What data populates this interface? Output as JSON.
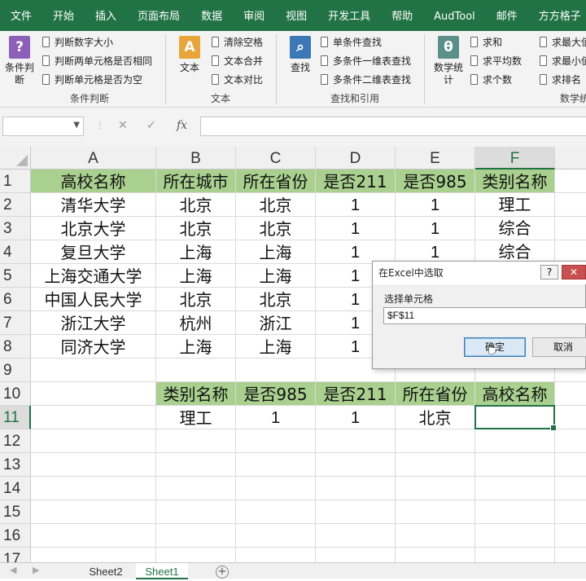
{
  "ribbon_tabs": [
    "文件",
    "开始",
    "插入",
    "页面布局",
    "数据",
    "审阅",
    "视图",
    "开发工具",
    "帮助",
    "AudTool",
    "邮件",
    "方方格子"
  ],
  "ribbon": {
    "group1": {
      "big_label": "条件判\n断",
      "items": [
        "判断数字大小",
        "判断两单元格是否相同",
        "判断单元格是否为空"
      ],
      "label": "条件判断"
    },
    "group2": {
      "big_label": "文本",
      "items": [
        "清除空格",
        "文本合并",
        "文本对比"
      ],
      "label": "文本"
    },
    "group3": {
      "big_label": "查找",
      "items": [
        "单条件查找",
        "多条件一维表查找",
        "多条件二维表查找"
      ],
      "label": "查找和引用"
    },
    "group4": {
      "big_label": "数学统\n计",
      "items": [
        "求和",
        "求平均数",
        "求个数"
      ],
      "items2": [
        "求最大值",
        "求最小值",
        "求排名"
      ],
      "label": "数学统计"
    }
  },
  "formula_bar": {
    "name": "",
    "fx": "fx",
    "value": ""
  },
  "columns": [
    "A",
    "B",
    "C",
    "D",
    "E",
    "F"
  ],
  "rows": [
    "1",
    "2",
    "3",
    "4",
    "5",
    "6",
    "7",
    "8",
    "9",
    "10",
    "11",
    "12",
    "13",
    "14",
    "15",
    "16",
    "17"
  ],
  "table1": {
    "headers": [
      "高校名称",
      "所在城市",
      "所在省份",
      "是否211",
      "是否985",
      "类别名称"
    ],
    "rows": [
      [
        "清华大学",
        "北京",
        "北京",
        "1",
        "1",
        "理工"
      ],
      [
        "北京大学",
        "北京",
        "北京",
        "1",
        "1",
        "综合"
      ],
      [
        "复旦大学",
        "上海",
        "上海",
        "1",
        "1",
        "综合"
      ],
      [
        "上海交通大学",
        "上海",
        "上海",
        "1",
        "",
        ""
      ],
      [
        "中国人民大学",
        "北京",
        "北京",
        "1",
        "",
        ""
      ],
      [
        "浙江大学",
        "杭州",
        "浙江",
        "1",
        "",
        ""
      ],
      [
        "同济大学",
        "上海",
        "上海",
        "1",
        "",
        ""
      ]
    ]
  },
  "table2": {
    "headers": [
      "类别名称",
      "是否985",
      "是否211",
      "所在省份",
      "高校名称"
    ],
    "values": [
      "理工",
      "1",
      "1",
      "北京",
      ""
    ]
  },
  "dialog": {
    "title": "在Excel中选取",
    "help": "?",
    "close": "✕",
    "label": "选择单元格",
    "value": "$F$11",
    "ok": "确定",
    "cancel": "取消"
  },
  "sheets": [
    "Sheet2",
    "Sheet1"
  ],
  "colors": {
    "excel_green": "#217346",
    "header_fill": "#a9d08e"
  }
}
